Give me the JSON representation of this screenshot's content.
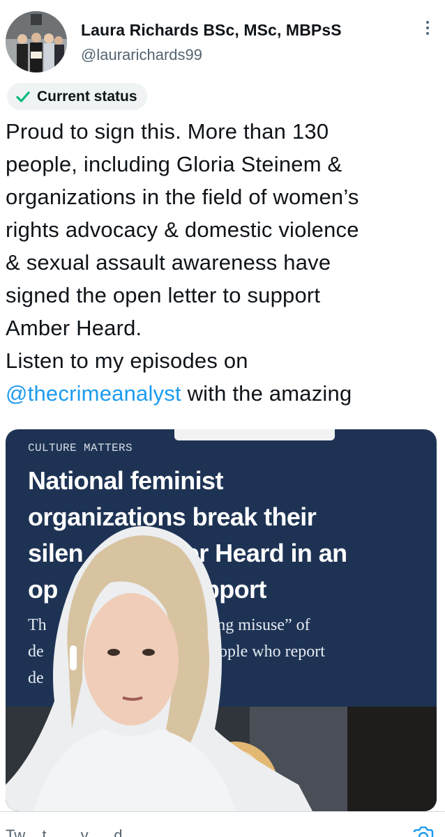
{
  "author": {
    "name": "Laura Richards BSc, MSc, MBPsS",
    "handle": "@laurarichards99"
  },
  "status_badge": {
    "icon": "check-icon",
    "label": "Current status",
    "icon_color": "#00ba7c"
  },
  "tweet": {
    "lines": [
      "Proud to sign this. More than 130",
      "people, including Gloria Steinem &",
      "organizations in the field of women’s",
      "rights advocacy & domestic violence",
      "& sexual assault awareness have",
      "signed the open letter to support",
      "Amber Heard.",
      "Listen to my episodes on"
    ],
    "mention": "@thecrimeanalyst",
    "after_mention": " with the amazing"
  },
  "media": {
    "kicker": "CULTURE MATTERS",
    "headline_lines": [
      "National feminist",
      "organizations break their",
      "silen          mber Heard in an",
      "op                  support"
    ],
    "dek_lines": [
      "Th                              ie “rising misuse” of",
      "de                          silence people who report",
      "de                            buse."
    ]
  },
  "footer": {
    "partial_text": "Tw    t        y      d"
  },
  "colors": {
    "accent": "#1d9bf0",
    "card_background": "#1e3354",
    "secondary_text": "#536471"
  }
}
